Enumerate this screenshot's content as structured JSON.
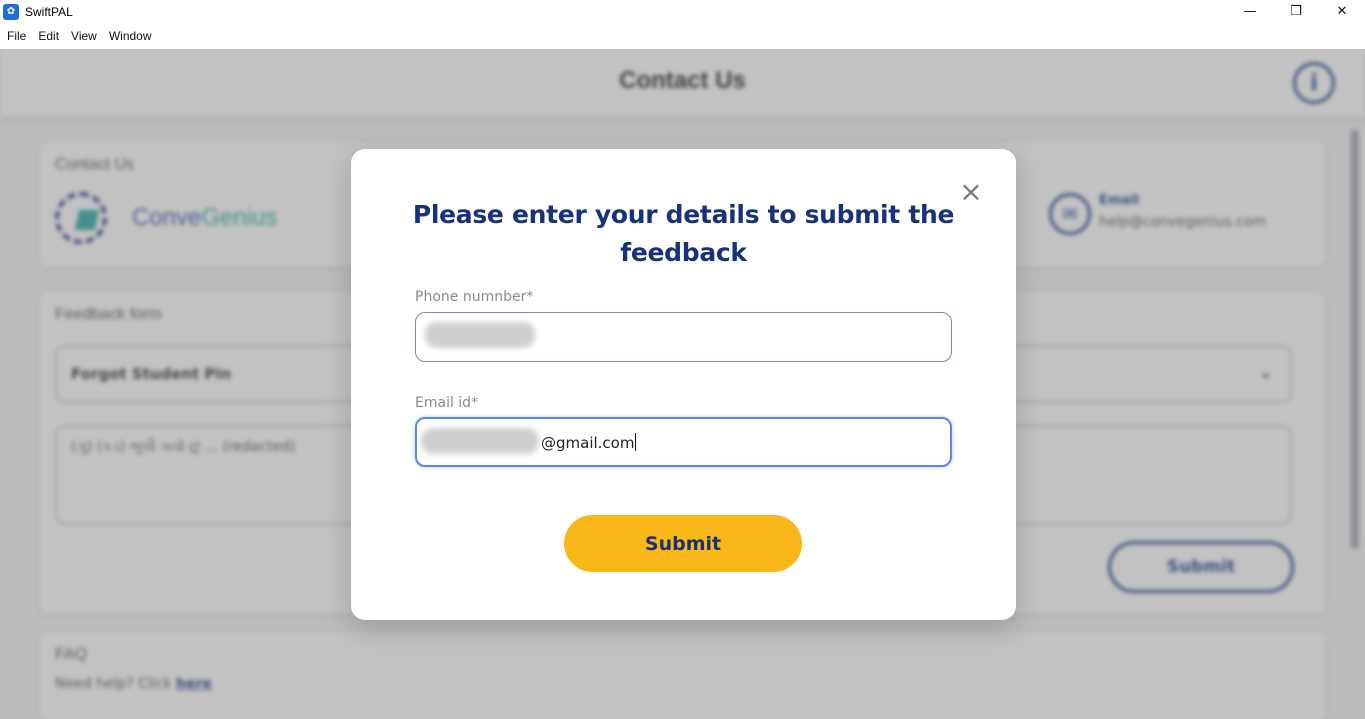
{
  "window": {
    "title": "SwiftPAL",
    "controls": {
      "minimize": "—",
      "maximize": "❐",
      "close": "✕"
    }
  },
  "menubar": {
    "items": [
      "File",
      "Edit",
      "View",
      "Window"
    ]
  },
  "background": {
    "page_title": "Contact Us",
    "info_icon": "i",
    "contact_card": {
      "heading": "Contact Us",
      "logo_text_main": "Conve",
      "logo_text_accent": "Genius",
      "email_label": "Email",
      "email_value": "help@convegenius.com"
    },
    "feedback_card": {
      "heading": "Feedback form",
      "select_value": "Forgot Student Pin",
      "textarea_value": "(ગુ) (કડ) ભૂલી ગયો છું ... (redacted)",
      "submit_label": "Submit"
    },
    "faq_card": {
      "heading": "FAQ",
      "help_text": "Need help? Click",
      "help_link": "here"
    }
  },
  "modal": {
    "title": "Please enter your details to submit the feedback",
    "close_icon": "×",
    "phone": {
      "label": "Phone numnber*",
      "value": ""
    },
    "email": {
      "label": "Email id*",
      "value": "@gmail.com"
    },
    "submit_label": "Submit"
  },
  "colors": {
    "brand_navy": "#17327a",
    "submit_yellow": "#f9b71a",
    "focus_blue": "#5f86e8",
    "overlay": "rgba(110,110,110,0.42)"
  }
}
